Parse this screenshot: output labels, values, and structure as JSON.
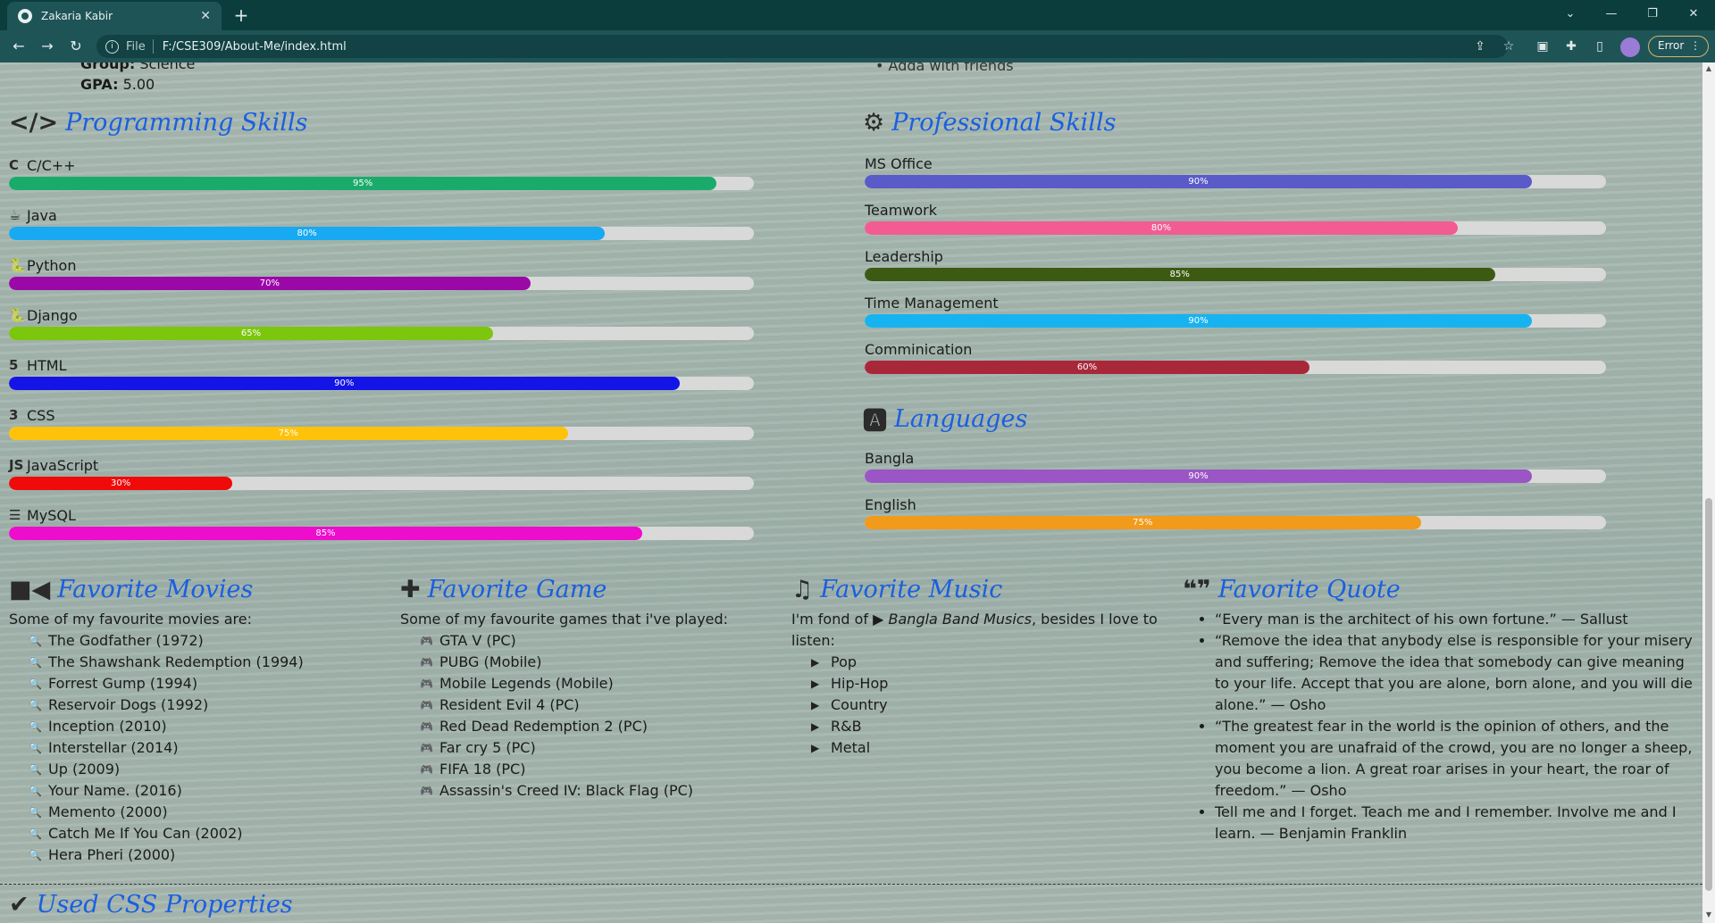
{
  "browser": {
    "tab_title": "Zakaria Kabir",
    "tab_close": "✕",
    "new_tab": "+",
    "url_scheme": "File",
    "url_path": "F:/CSE309/About-Me/index.html",
    "error_label": "Error"
  },
  "education": {
    "group_label": "Group:",
    "group_value": "Science",
    "gpa_label": "GPA:",
    "gpa_value": "5.00",
    "clipped_hobby": "Adda with friends"
  },
  "programming": {
    "title": "Programming Skills",
    "skills": [
      {
        "name": "C/C++",
        "percent": "95%",
        "value": 95,
        "color": "#1aab6b"
      },
      {
        "name": "Java",
        "percent": "80%",
        "value": 80,
        "color": "#17a9f2"
      },
      {
        "name": "Python",
        "percent": "70%",
        "value": 70,
        "color": "#9b08a8"
      },
      {
        "name": "Django",
        "percent": "65%",
        "value": 65,
        "color": "#7cc60e"
      },
      {
        "name": "HTML",
        "percent": "90%",
        "value": 90,
        "color": "#1414e6"
      },
      {
        "name": "CSS",
        "percent": "75%",
        "value": 75,
        "color": "#ffc20a"
      },
      {
        "name": "JavaScript",
        "percent": "30%",
        "value": 30,
        "color": "#f00a0a"
      },
      {
        "name": "MySQL",
        "percent": "85%",
        "value": 85,
        "color": "#ee0ccd"
      }
    ]
  },
  "professional": {
    "title": "Professional Skills",
    "skills": [
      {
        "name": "MS Office",
        "percent": "90%",
        "value": 90,
        "color": "#5a5ac8"
      },
      {
        "name": "Teamwork",
        "percent": "80%",
        "value": 80,
        "color": "#f25c92"
      },
      {
        "name": "Leadership",
        "percent": "85%",
        "value": 85,
        "color": "#3d5a12"
      },
      {
        "name": "Time Management",
        "percent": "90%",
        "value": 90,
        "color": "#17b3f0"
      },
      {
        "name": "Comminication",
        "percent": "60%",
        "value": 60,
        "color": "#a8283a"
      }
    ]
  },
  "languages": {
    "title": "Languages",
    "skills": [
      {
        "name": "Bangla",
        "percent": "90%",
        "value": 90,
        "color": "#9b55c4"
      },
      {
        "name": "English",
        "percent": "75%",
        "value": 75,
        "color": "#f29a1a"
      }
    ]
  },
  "movies": {
    "title": "Favorite Movies",
    "intro": "Some of my favourite movies are:",
    "items": [
      "The Godfather (1972)",
      "The Shawshank Redemption (1994)",
      "Forrest Gump (1994)",
      "Reservoir Dogs (1992)",
      "Inception (2010)",
      "Interstellar (2014)",
      "Up (2009)",
      "Your Name. (2016)",
      "Memento (2000)",
      "Catch Me If You Can (2002)",
      "Hera Pheri (2000)"
    ]
  },
  "games": {
    "title": "Favorite Game",
    "intro": "Some of my favourite games that i've played:",
    "items": [
      "GTA V (PC)",
      "PUBG (Mobile)",
      "Mobile Legends (Mobile)",
      "Resident Evil 4 (PC)",
      "Red Dead Redemption 2 (PC)",
      "Far cry 5 (PC)",
      "FIFA 18 (PC)",
      "Assassin's Creed IV: Black Flag (PC)"
    ]
  },
  "music": {
    "title": "Favorite Music",
    "intro_a": "I'm fond of",
    "intro_em": "Bangla Band Musics",
    "intro_b": ", besides I love to listen:",
    "items": [
      "Pop",
      "Hip-Hop",
      "Country",
      "R&B",
      "Metal"
    ]
  },
  "quote": {
    "title": "Favorite Quote",
    "items": [
      "“Every man is the architect of his own fortune.” — Sallust",
      "“Remove the idea that anybody else is responsible for your misery and suffering; Remove the idea that somebody can give meaning to your life. Accept that you are alone, born alone, and you will die alone.” — Osho",
      "“The greatest fear in the world is the opinion of others, and the moment you are unafraid of the crowd, you are no longer a sheep, you become a lion. A great roar arises in your heart, the roar of freedom.” — Osho",
      "Tell me and I forget. Teach me and I remember. Involve me and I learn. — Benjamin Franklin"
    ]
  },
  "css_section": {
    "title": "Used CSS Properties"
  }
}
